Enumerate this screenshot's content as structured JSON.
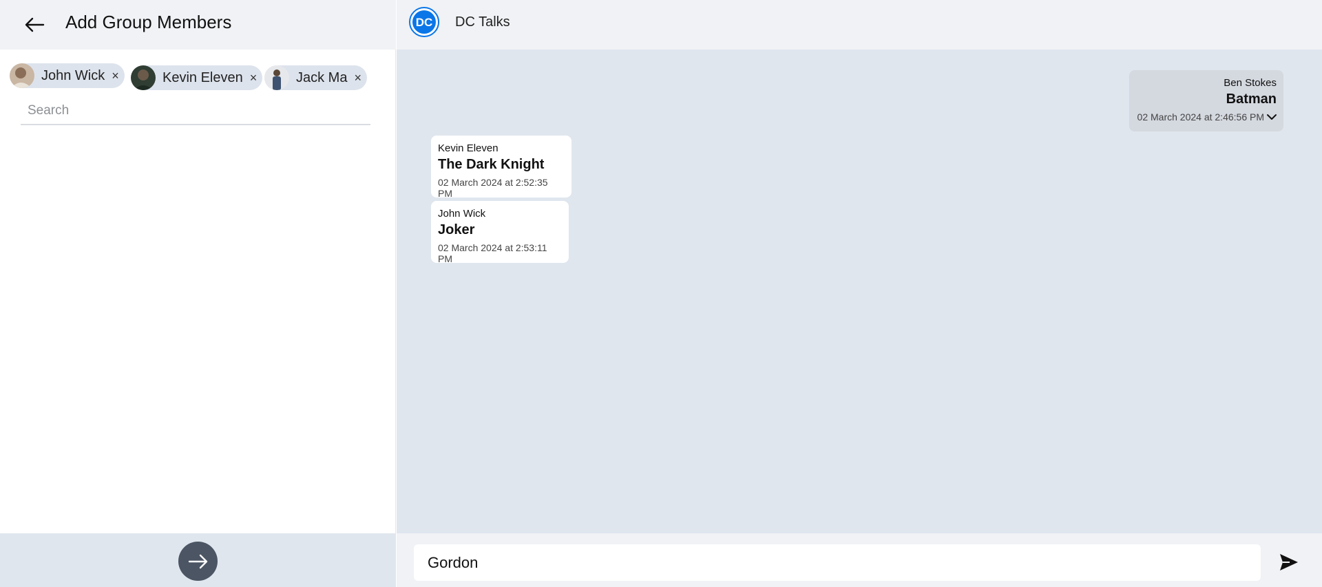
{
  "left_panel": {
    "title": "Add Group Members",
    "selected_members": [
      {
        "name": "John Wick"
      },
      {
        "name": "Kevin Eleven"
      },
      {
        "name": "Jack Ma"
      }
    ],
    "remove_glyph": "×",
    "search": {
      "placeholder": "Search",
      "value": ""
    },
    "icons": {
      "back": "arrow-left-icon",
      "next": "arrow-right-icon"
    }
  },
  "chat": {
    "group_name": "DC Talks",
    "group_logo_text": "DC",
    "messages": [
      {
        "direction": "outgoing",
        "sender": "Ben Stokes",
        "text": "Batman",
        "time": "02 March 2024 at 2:46:56 PM"
      },
      {
        "direction": "incoming",
        "sender": "Kevin Eleven",
        "text": "The Dark Knight",
        "time": "02 March 2024 at 2:52:35 PM"
      },
      {
        "direction": "incoming",
        "sender": "John Wick",
        "text": "Joker",
        "time": "02 March 2024 at 2:53:11 PM"
      }
    ],
    "composer": {
      "value": "Gordon"
    }
  },
  "colors": {
    "header_bg": "#f0f2f5",
    "chat_bg": "#e0e6ee",
    "accent_blue": "#0a76e8",
    "fab_bg": "#4b5563"
  }
}
